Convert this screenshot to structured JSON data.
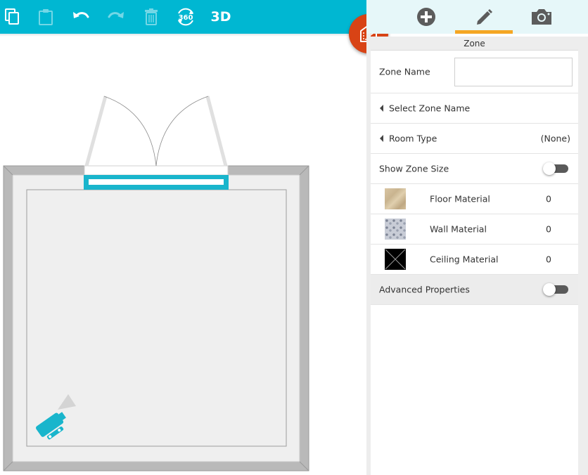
{
  "toolbar": {
    "buttons": [
      {
        "name": "copy",
        "icon": "copy-icon",
        "enabled": true
      },
      {
        "name": "paste",
        "icon": "clipboard-icon",
        "enabled": false
      },
      {
        "name": "undo",
        "icon": "undo-icon",
        "enabled": true
      },
      {
        "name": "redo",
        "icon": "redo-icon",
        "enabled": false
      },
      {
        "name": "delete",
        "icon": "trash-icon",
        "enabled": false
      },
      {
        "name": "view-360",
        "icon": "rotate-360-icon",
        "enabled": true,
        "label": "360"
      },
      {
        "name": "view-3d",
        "icon": "",
        "enabled": true,
        "label": "3D"
      }
    ],
    "color": "#00b7d2"
  },
  "fab": {
    "icon": "room-zone-icon",
    "color": "#d84315"
  },
  "panel": {
    "tabs": [
      {
        "icon": "plus-icon",
        "active": false
      },
      {
        "icon": "pencil-icon",
        "active": true
      },
      {
        "icon": "camera-icon",
        "active": false
      }
    ],
    "active_tab_color": "#f5a623",
    "header": "Zone",
    "zone_name": {
      "label": "Zone Name",
      "value": ""
    },
    "select_zone_name": {
      "label": "Select Zone Name"
    },
    "room_type": {
      "label": "Room Type",
      "value": "(None)"
    },
    "show_zone_size": {
      "label": "Show Zone Size",
      "on": false
    },
    "materials": [
      {
        "label": "Floor Material",
        "count": "0",
        "swatch": "wood-texture"
      },
      {
        "label": "Wall Material",
        "count": "0",
        "swatch": "patterned-wallpaper"
      },
      {
        "label": "Ceiling Material",
        "count": "0",
        "swatch": "none"
      }
    ],
    "advanced": {
      "label": "Advanced Properties",
      "on": false
    }
  }
}
